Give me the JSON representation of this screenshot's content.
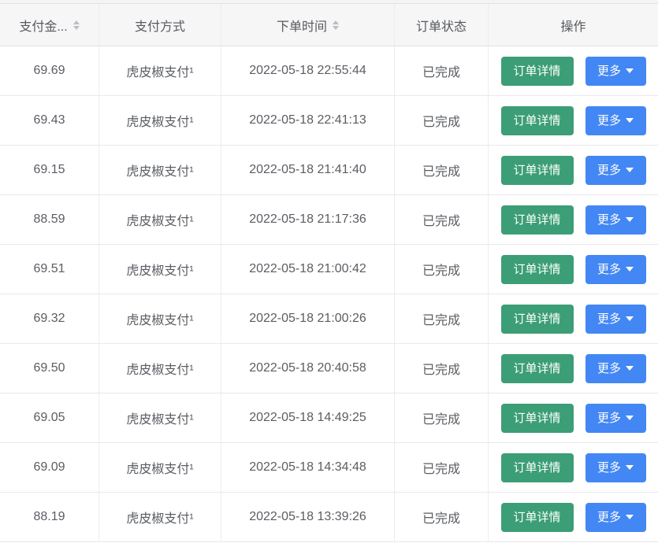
{
  "colors": {
    "green": "#3c9e76",
    "blue": "#4387f4",
    "header-bg": "#f6f6f7",
    "row-border": "#e9e9eb",
    "col-border": "#ededf0",
    "text": "#5a5d62",
    "sort-icon": "#b9bdc4"
  },
  "header": {
    "amount": "支付金...",
    "method": "支付方式",
    "time": "下单时间",
    "status": "订单状态",
    "actions": "操作"
  },
  "buttons": {
    "detail": "订单详情",
    "more": "更多"
  },
  "icons": {
    "amount_sorter": "caret-up-down-icon",
    "time_sorter": "caret-up-down-icon",
    "more_arrow": "caret-down-icon"
  },
  "rows": [
    {
      "amount": "69.69",
      "method": "虎皮椒支付¹",
      "time": "2022-05-18 22:55:44",
      "status": "已完成"
    },
    {
      "amount": "69.43",
      "method": "虎皮椒支付¹",
      "time": "2022-05-18 22:41:13",
      "status": "已完成"
    },
    {
      "amount": "69.15",
      "method": "虎皮椒支付¹",
      "time": "2022-05-18 21:41:40",
      "status": "已完成"
    },
    {
      "amount": "88.59",
      "method": "虎皮椒支付¹",
      "time": "2022-05-18 21:17:36",
      "status": "已完成"
    },
    {
      "amount": "69.51",
      "method": "虎皮椒支付¹",
      "time": "2022-05-18 21:00:42",
      "status": "已完成"
    },
    {
      "amount": "69.32",
      "method": "虎皮椒支付¹",
      "time": "2022-05-18 21:00:26",
      "status": "已完成"
    },
    {
      "amount": "69.50",
      "method": "虎皮椒支付¹",
      "time": "2022-05-18 20:40:58",
      "status": "已完成"
    },
    {
      "amount": "69.05",
      "method": "虎皮椒支付¹",
      "time": "2022-05-18 14:49:25",
      "status": "已完成"
    },
    {
      "amount": "69.09",
      "method": "虎皮椒支付¹",
      "time": "2022-05-18 14:34:48",
      "status": "已完成"
    },
    {
      "amount": "88.19",
      "method": "虎皮椒支付¹",
      "time": "2022-05-18 13:39:26",
      "status": "已完成"
    }
  ]
}
